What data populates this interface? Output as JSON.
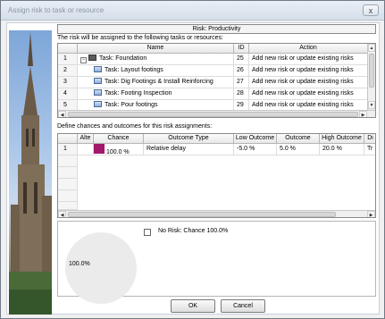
{
  "window": {
    "title": "Assign risk to task or resource",
    "close_symbol": "x"
  },
  "risk_header": "Risk: Productivity",
  "assign_label": "The risk will be assigned to the following tasks or resources:",
  "tasks_table": {
    "columns": [
      "Name",
      "ID",
      "Action"
    ],
    "rows": [
      {
        "num": "1",
        "name": "Task: Foundation",
        "id": "25",
        "action": "Add new risk or update existing risks",
        "summary": true
      },
      {
        "num": "2",
        "name": "Task: Layout footings",
        "id": "26",
        "action": "Add new risk or update existing risks"
      },
      {
        "num": "3",
        "name": "Task: Dig Footings & Install Reinforcing",
        "id": "27",
        "action": "Add new risk or update existing risks"
      },
      {
        "num": "4",
        "name": "Task: Footing Inspection",
        "id": "28",
        "action": "Add new risk or update existing risks"
      },
      {
        "num": "5",
        "name": "Task: Pour footings",
        "id": "29",
        "action": "Add new risk or update existing risks"
      }
    ]
  },
  "define_label": "Define chances and outcomes for this risk assignments:",
  "outcomes_table": {
    "columns": [
      "Alte",
      "Chance",
      "Outcome Type",
      "Low Outcome",
      "Outcome",
      "High Outcome",
      "Di"
    ],
    "rows": [
      {
        "num": "1",
        "chance": "100.0 %",
        "outcome_type": "Relative delay",
        "low": "-5.0 %",
        "outcome": "5.0 %",
        "high": "20.0 %",
        "di": "Tr",
        "swatch_color": "#a3186c"
      }
    ]
  },
  "chart": {
    "pie_label": "100.0%",
    "legend": "No Risk: Chance 100.0%"
  },
  "buttons": {
    "ok": "OK",
    "cancel": "Cancel"
  }
}
